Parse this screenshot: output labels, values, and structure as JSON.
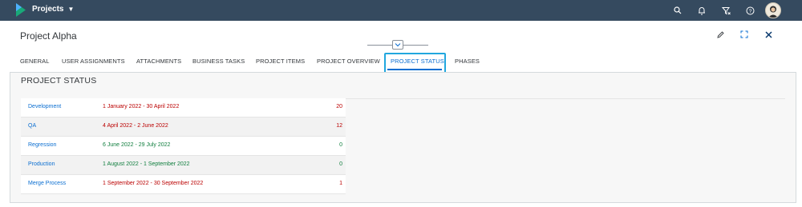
{
  "shell": {
    "app_title": "Projects",
    "icons": [
      "search-icon",
      "bell-icon",
      "filter-icon",
      "help-icon",
      "avatar"
    ]
  },
  "header": {
    "title": "Project Alpha",
    "actions": [
      "edit-icon",
      "fullscreen-icon",
      "close-icon"
    ]
  },
  "tabs": [
    {
      "label": "GENERAL"
    },
    {
      "label": "USER ASSIGNMENTS"
    },
    {
      "label": "ATTACHMENTS"
    },
    {
      "label": "BUSINESS TASKS"
    },
    {
      "label": "PROJECT ITEMS"
    },
    {
      "label": "PROJECT OVERVIEW"
    },
    {
      "label": "PROJECT STATUS",
      "active": true
    },
    {
      "label": "PHASES"
    }
  ],
  "section": {
    "title": "PROJECT STATUS"
  },
  "status_rows": [
    {
      "name": "Development",
      "range": "1 January 2022 - 30 April 2022",
      "value": "20",
      "state": "negative"
    },
    {
      "name": "QA",
      "range": "4 April 2022 - 2 June 2022",
      "value": "12",
      "state": "negative"
    },
    {
      "name": "Regression",
      "range": "6 June 2022 - 29 July 2022",
      "value": "0",
      "state": "positive"
    },
    {
      "name": "Production",
      "range": "1 August 2022 - 1 September 2022",
      "value": "0",
      "state": "positive"
    },
    {
      "name": "Merge Process",
      "range": "1 September 2022 - 30 September 2022",
      "value": "1",
      "state": "negative"
    }
  ],
  "colors": {
    "shell": "#354a5f",
    "link": "#0a6ed1",
    "negative": "#bb0000",
    "positive": "#107e3e",
    "focus": "#21a7de"
  }
}
